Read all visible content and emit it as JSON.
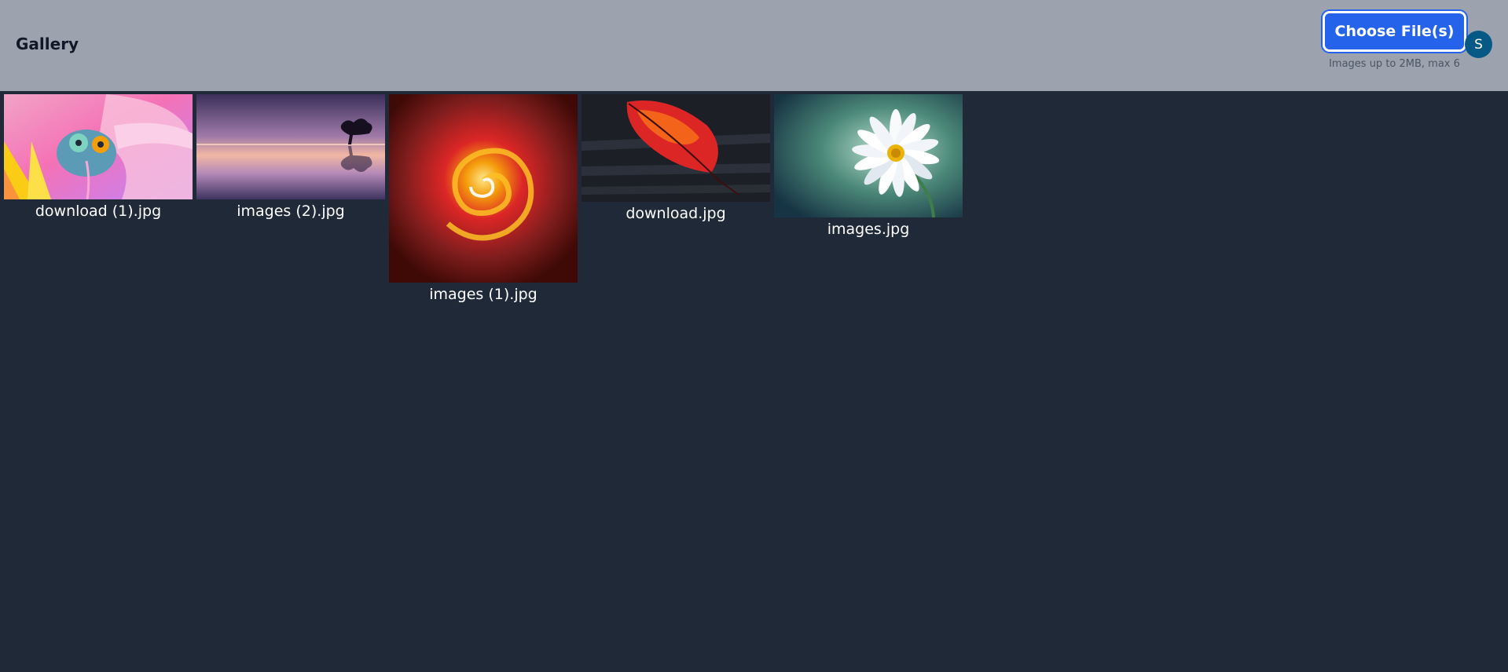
{
  "header": {
    "title": "Gallery",
    "upload_button": "Choose File(s)",
    "upload_hint": "Images up to 2MB, max 6",
    "avatar_initial": "S"
  },
  "colors": {
    "header_bg": "#9ca3af",
    "page_bg": "#1f2937",
    "accent": "#2563eb",
    "avatar_bg": "#075985"
  },
  "gallery": {
    "images": [
      {
        "name": "download (1).jpg",
        "subject": "chameleon-on-flower"
      },
      {
        "name": "images (2).jpg",
        "subject": "lake-sunset-tree"
      },
      {
        "name": "images (1).jpg",
        "subject": "fire-swirl"
      },
      {
        "name": "download.jpg",
        "subject": "autumn-leaf-on-wood"
      },
      {
        "name": "images.jpg",
        "subject": "white-daisy"
      }
    ]
  }
}
